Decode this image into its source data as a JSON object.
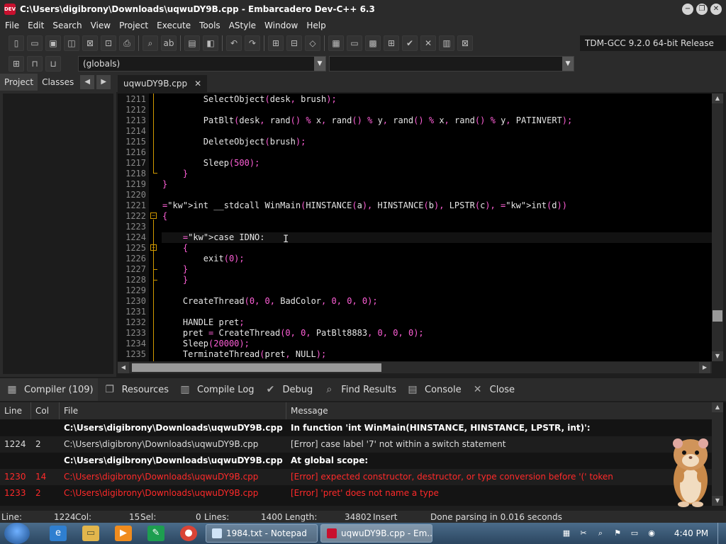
{
  "window": {
    "title": "C:\\Users\\digibrony\\Downloads\\uqwuDY9B.cpp - Embarcadero Dev-C++ 6.3",
    "app_icon_text": "DEV"
  },
  "menu": [
    "File",
    "Edit",
    "Search",
    "View",
    "Project",
    "Execute",
    "Tools",
    "AStyle",
    "Window",
    "Help"
  ],
  "toolbar": {
    "compiler": "TDM-GCC 9.2.0 64-bit Release",
    "scope_combo": "(globals)",
    "function_combo": ""
  },
  "left_panel": {
    "tabs": [
      "Project",
      "Classes"
    ],
    "nav_prev": "◀",
    "nav_next": "▶"
  },
  "editor": {
    "tab_label": "uqwuDY9B.cpp",
    "tab_close": "✕",
    "lines": [
      {
        "n": "1211",
        "code": "        SelectObject(desk, brush);"
      },
      {
        "n": "1212",
        "code": ""
      },
      {
        "n": "1213",
        "code": "        PatBlt(desk, rand() % x, rand() % y, rand() % x, rand() % y, PATINVERT);"
      },
      {
        "n": "1214",
        "code": ""
      },
      {
        "n": "1215",
        "code": "        DeleteObject(brush);"
      },
      {
        "n": "1216",
        "code": ""
      },
      {
        "n": "1217",
        "code": "        Sleep(500);"
      },
      {
        "n": "1218",
        "code": "    }"
      },
      {
        "n": "1219",
        "code": "}"
      },
      {
        "n": "1220",
        "code": ""
      },
      {
        "n": "1221",
        "code": "int __stdcall WinMain(HINSTANCE(a), HINSTANCE(b), LPSTR(c), int(d))"
      },
      {
        "n": "1222",
        "code": "{"
      },
      {
        "n": "1223",
        "code": ""
      },
      {
        "n": "1224",
        "code": "    case IDNO:"
      },
      {
        "n": "1225",
        "code": "    {"
      },
      {
        "n": "1226",
        "code": "        exit(0);"
      },
      {
        "n": "1227",
        "code": "    }"
      },
      {
        "n": "1228",
        "code": "    }"
      },
      {
        "n": "1229",
        "code": ""
      },
      {
        "n": "1230",
        "code": "    CreateThread(0, 0, BadColor, 0, 0, 0);"
      },
      {
        "n": "1231",
        "code": ""
      },
      {
        "n": "1232",
        "code": "    HANDLE pret;"
      },
      {
        "n": "1233",
        "code": "    pret = CreateThread(0, 0, PatBlt8883, 0, 0, 0);"
      },
      {
        "n": "1234",
        "code": "    Sleep(20000);"
      },
      {
        "n": "1235",
        "code": "    TerminateThread(pret, NULL);"
      }
    ]
  },
  "bottom_tabs": [
    {
      "icon": "grid-icon",
      "glyph": "▦",
      "label": "Compiler (109)"
    },
    {
      "icon": "resources-icon",
      "glyph": "❐",
      "label": "Resources"
    },
    {
      "icon": "compile-log-icon",
      "glyph": "▥",
      "label": "Compile Log"
    },
    {
      "icon": "debug-check-icon",
      "glyph": "✔",
      "label": "Debug"
    },
    {
      "icon": "find-icon",
      "glyph": "⌕",
      "label": "Find Results"
    },
    {
      "icon": "console-icon",
      "glyph": "▤",
      "label": "Console"
    },
    {
      "icon": "close-x-icon",
      "glyph": "✕",
      "label": "Close"
    }
  ],
  "messages": {
    "columns": [
      "Line",
      "Col",
      "File",
      "Message"
    ],
    "rows": [
      {
        "type": "bold",
        "line": "",
        "col": "",
        "file": "C:\\Users\\digibrony\\Downloads\\uqwuDY9B.cpp",
        "msg": "In function 'int WinMain(HINSTANCE, HINSTANCE, LPSTR, int)':"
      },
      {
        "type": "normal",
        "line": "1224",
        "col": "2",
        "file": "C:\\Users\\digibrony\\Downloads\\uqwuDY9B.cpp",
        "msg": "[Error] case label '7' not within a switch statement"
      },
      {
        "type": "bold",
        "line": "",
        "col": "",
        "file": "C:\\Users\\digibrony\\Downloads\\uqwuDY9B.cpp",
        "msg": "At global scope:"
      },
      {
        "type": "err",
        "line": "1230",
        "col": "14",
        "file": "C:\\Users\\digibrony\\Downloads\\uqwuDY9B.cpp",
        "msg": "[Error] expected constructor, destructor, or type conversion before '(' token"
      },
      {
        "type": "err",
        "line": "1233",
        "col": "2",
        "file": "C:\\Users\\digibrony\\Downloads\\uqwuDY9B.cpp",
        "msg": "[Error] 'pret' does not name a type"
      }
    ]
  },
  "status": {
    "line_label": "Line:",
    "line_value": "1224",
    "col_label": "Col:",
    "col_value": "15",
    "sel_label": "Sel:",
    "sel_value": "0",
    "lines_label": "Lines:",
    "lines_value": "1400",
    "length_label": "Length:",
    "length_value": "34802",
    "mode": "Insert",
    "parse": "Done parsing in 0.016 seconds"
  },
  "taskbar": {
    "tasks": [
      "1984.txt - Notepad",
      "uqwuDY9B.cpp - Em..."
    ],
    "clock": "4:40 PM"
  },
  "colors": {
    "keyword": "#6ec6ff",
    "number": "#ff5fd7",
    "error": "#ff2a2a",
    "fold": "#d29a00"
  }
}
